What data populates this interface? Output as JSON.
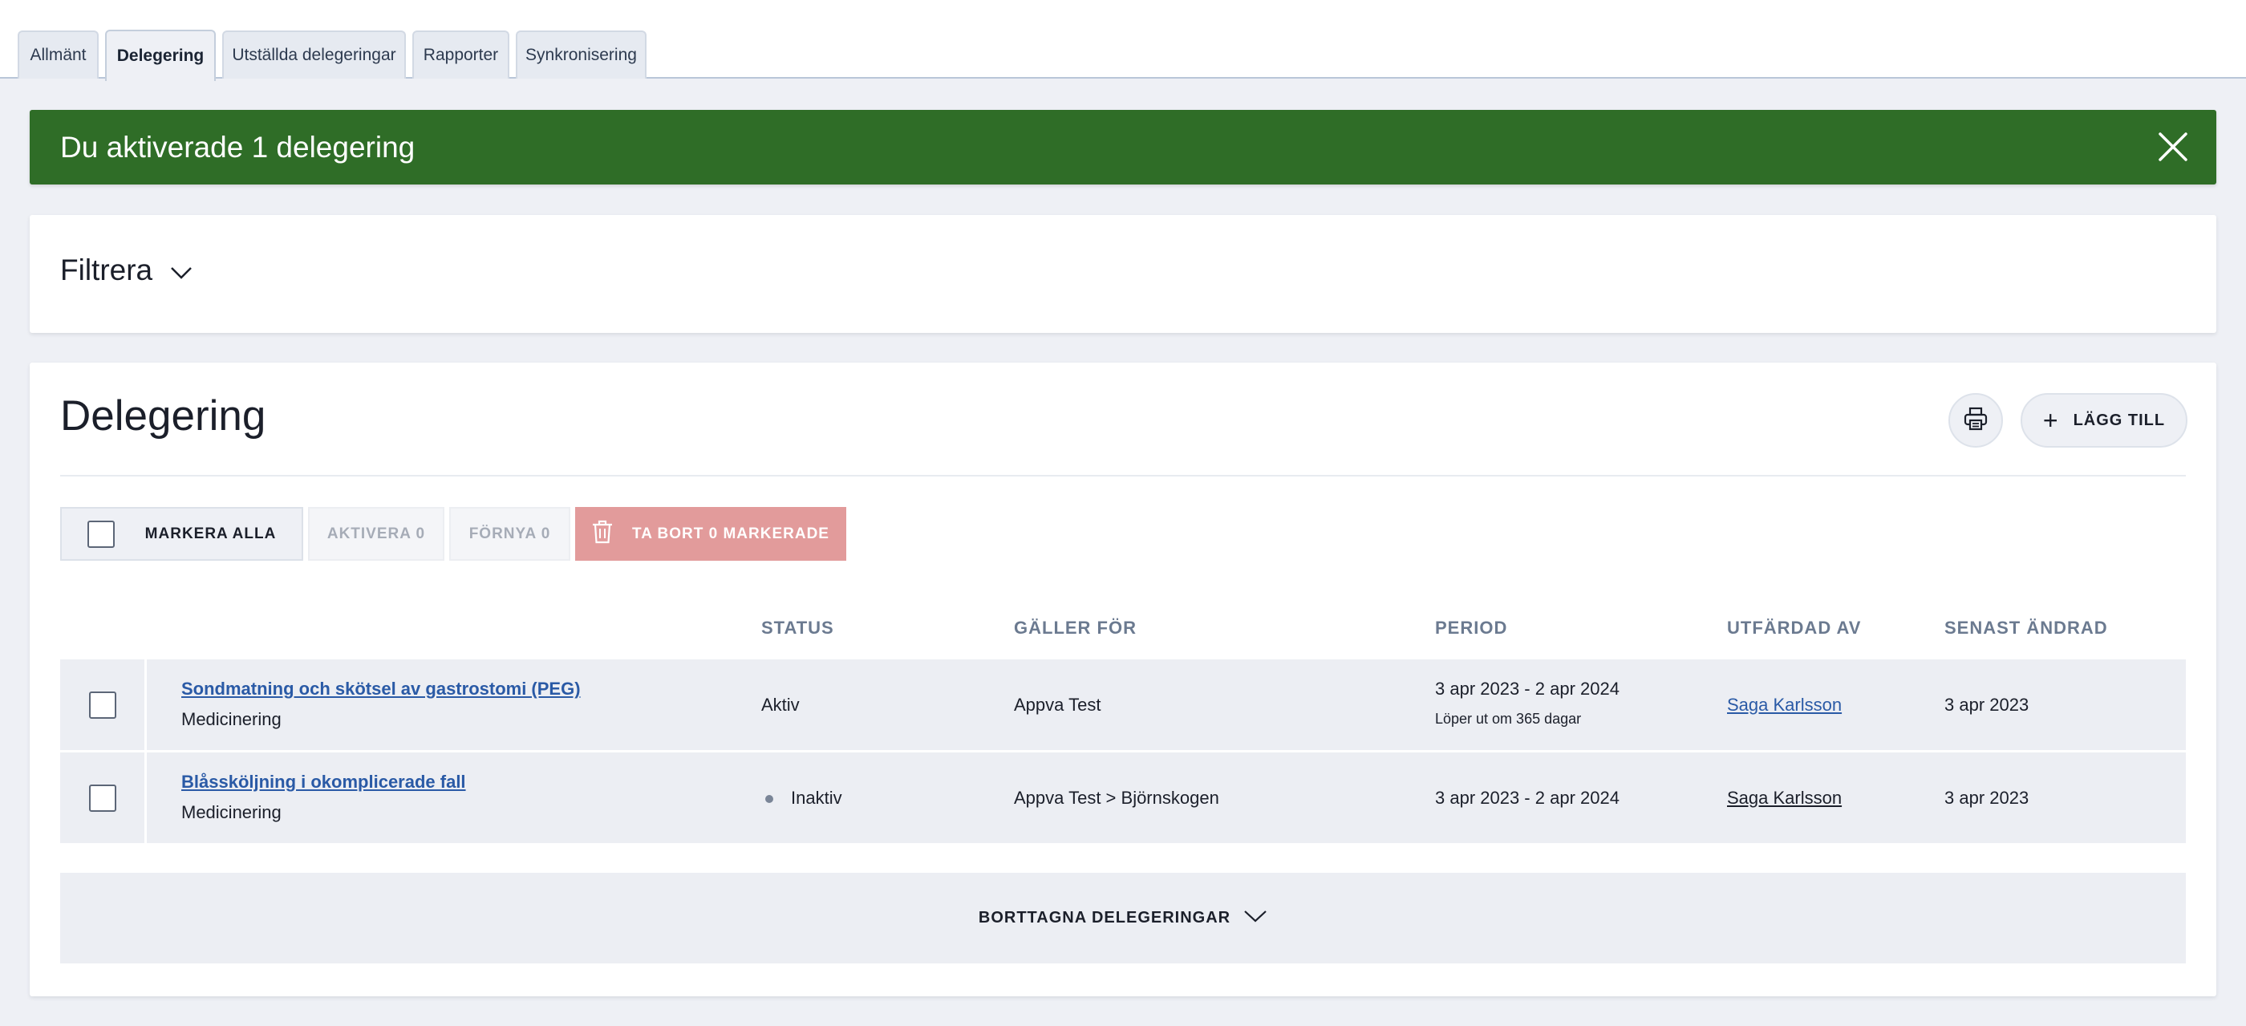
{
  "tabs": [
    {
      "label": "Allmänt"
    },
    {
      "label": "Delegering"
    },
    {
      "label": "Utställda delegeringar"
    },
    {
      "label": "Rapporter"
    },
    {
      "label": "Synkronisering"
    }
  ],
  "active_tab": "Delegering",
  "alert": {
    "message": "Du aktiverade 1 delegering",
    "color": "#2f6d27"
  },
  "filter": {
    "title": "Filtrera"
  },
  "main": {
    "title": "Delegering",
    "add_label": "LÄGG TILL"
  },
  "bulk": {
    "select_all": "MARKERA ALLA",
    "activate": "AKTIVERA 0",
    "renew": "FÖRNYA 0",
    "delete": "TA BORT 0 MARKERADE"
  },
  "table": {
    "headers": {
      "status": "STATUS",
      "applies_to": "GÄLLER FÖR",
      "period": "PERIOD",
      "issued_by": "UTFÄRDAD AV",
      "last_changed": "SENAST ÄNDRAD"
    },
    "rows": [
      {
        "title": "Sondmatning och skötsel av gastrostomi (PEG)",
        "category": "Medicinering",
        "status": "Aktiv",
        "applies_to": "Appva Test",
        "period": "3 apr 2023 - 2 apr 2024",
        "period_note": "Löper ut om 365 dagar",
        "issued_by": "Saga Karlsson",
        "last_changed": "3 apr 2023"
      },
      {
        "title": "Blåssköljning i okomplicerade fall",
        "category": "Medicinering",
        "status": "Inaktiv",
        "applies_to": "Appva Test > Björnskogen",
        "period": "3 apr 2023 - 2 apr 2024",
        "issued_by": "Saga Karlsson",
        "last_changed": "3 apr 2023"
      }
    ]
  },
  "removed": {
    "label": "BORTTAGNA DELEGERINGAR"
  },
  "icons": [
    "close-icon",
    "chevron-down-icon",
    "printer-icon",
    "plus-icon",
    "trash-icon",
    "status-dot-icon"
  ]
}
